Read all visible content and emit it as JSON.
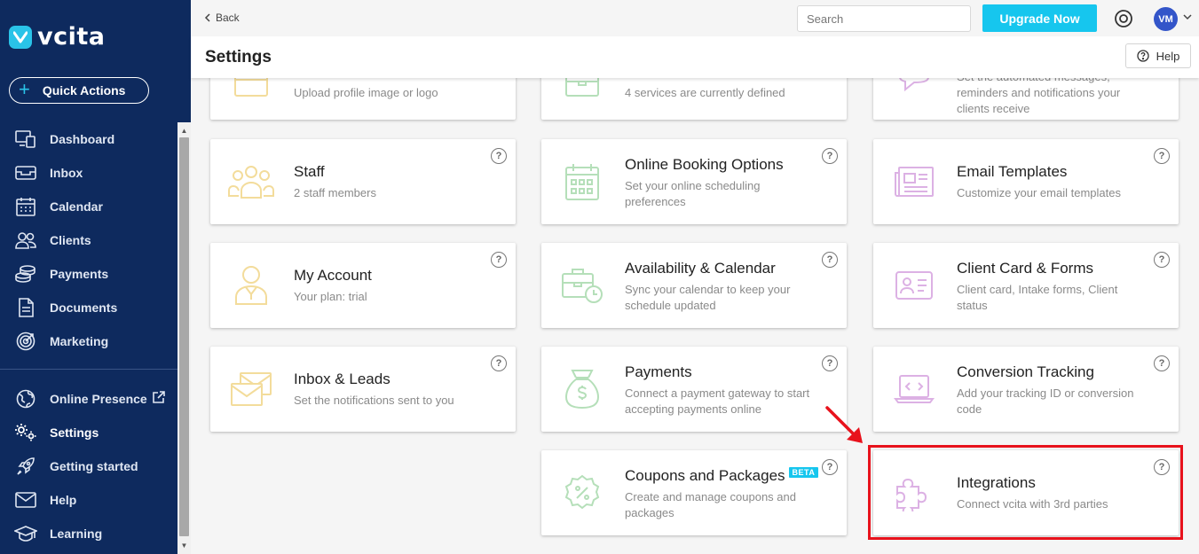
{
  "app": {
    "logo_text": "vcita",
    "quick_actions_label": "Quick Actions",
    "brand_color": "#0e2a5e",
    "accent_color": "#16c6ee"
  },
  "sidebar": {
    "items": [
      {
        "label": "Dashboard",
        "icon": "dashboard-icon"
      },
      {
        "label": "Inbox",
        "icon": "inbox-icon"
      },
      {
        "label": "Calendar",
        "icon": "calendar-icon"
      },
      {
        "label": "Clients",
        "icon": "clients-icon"
      },
      {
        "label": "Payments",
        "icon": "payments-icon"
      },
      {
        "label": "Documents",
        "icon": "documents-icon"
      },
      {
        "label": "Marketing",
        "icon": "marketing-icon"
      },
      {
        "label": "Online Presence",
        "icon": "globe-icon"
      },
      {
        "label": "Settings",
        "icon": "settings-icon",
        "active": true
      },
      {
        "label": "Getting started",
        "icon": "rocket-icon"
      },
      {
        "label": "Help",
        "icon": "mail-icon"
      },
      {
        "label": "Learning",
        "icon": "graduation-cap-icon"
      }
    ]
  },
  "topbar": {
    "back_label": "Back",
    "search_placeholder": "Search",
    "upgrade_label": "Upgrade Now",
    "avatar_initials": "VM"
  },
  "header": {
    "title": "Settings",
    "help_label": "Help"
  },
  "cards": {
    "row0": [
      {
        "title": "",
        "desc": "Upload profile image or logo"
      },
      {
        "title": "",
        "desc": "4 services are currently defined"
      },
      {
        "title": "",
        "desc": "Set the automated messages, reminders and notifications your clients receive"
      }
    ],
    "staff": {
      "title": "Staff",
      "desc": "2 staff members"
    },
    "online_booking": {
      "title": "Online Booking Options",
      "desc": "Set your online scheduling preferences"
    },
    "email_templates": {
      "title": "Email Templates",
      "desc": "Customize your email templates"
    },
    "my_account": {
      "title": "My Account",
      "desc": "Your plan: trial"
    },
    "availability": {
      "title": "Availability & Calendar",
      "desc": "Sync your calendar to keep your schedule updated"
    },
    "client_card": {
      "title": "Client Card & Forms",
      "desc": "Client card, Intake forms, Client status"
    },
    "inbox_leads": {
      "title": "Inbox & Leads",
      "desc": "Set the notifications sent to you"
    },
    "payments": {
      "title": "Payments",
      "desc": "Connect a payment gateway to start accepting payments online"
    },
    "conversion": {
      "title": "Conversion Tracking",
      "desc": "Add your tracking ID or conversion code"
    },
    "coupons": {
      "title": "Coupons and Packages",
      "badge": "BETA",
      "desc": "Create and manage coupons and packages"
    },
    "integrations": {
      "title": "Integrations",
      "desc": "Connect vcita with 3rd parties"
    },
    "help_glyph": "?"
  },
  "colors": {
    "yellow_icon": "#f3dc9b",
    "green_icon": "#b5dfb9",
    "purple_icon": "#dcb1e4",
    "highlight": "#e8121c"
  }
}
